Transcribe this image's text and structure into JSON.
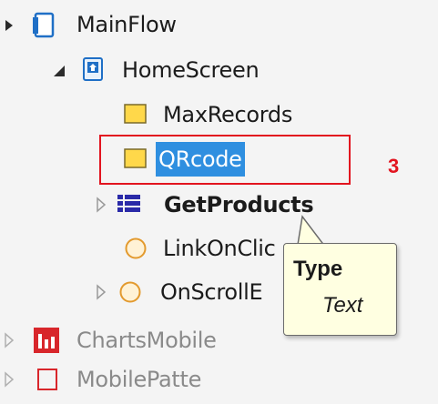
{
  "tree": {
    "items": [
      {
        "label": "MainFlow",
        "icon": "screen-flow-icon"
      },
      {
        "label": "HomeScreen",
        "icon": "screen-icon"
      },
      {
        "label": "MaxRecords",
        "icon": "local-variable-icon"
      },
      {
        "label": "QRcode",
        "icon": "local-variable-icon",
        "selected": true
      },
      {
        "label": "GetProducts",
        "icon": "aggregate-icon"
      },
      {
        "label": "LinkOnClic",
        "icon": "client-action-icon"
      },
      {
        "label": "OnScrollE",
        "icon": "client-action-icon"
      },
      {
        "label": "ChartsMobile",
        "icon": "charts-icon"
      },
      {
        "label": "MobilePatte",
        "icon": "module-icon"
      }
    ]
  },
  "annotation": {
    "text": "3",
    "color": "#e2141f"
  },
  "tooltip": {
    "title": "Type",
    "value": "Text"
  },
  "colors": {
    "selection": "#2f8fe0",
    "highlight_box": "#e2141f",
    "tooltip_bg": "#ffffe1"
  }
}
